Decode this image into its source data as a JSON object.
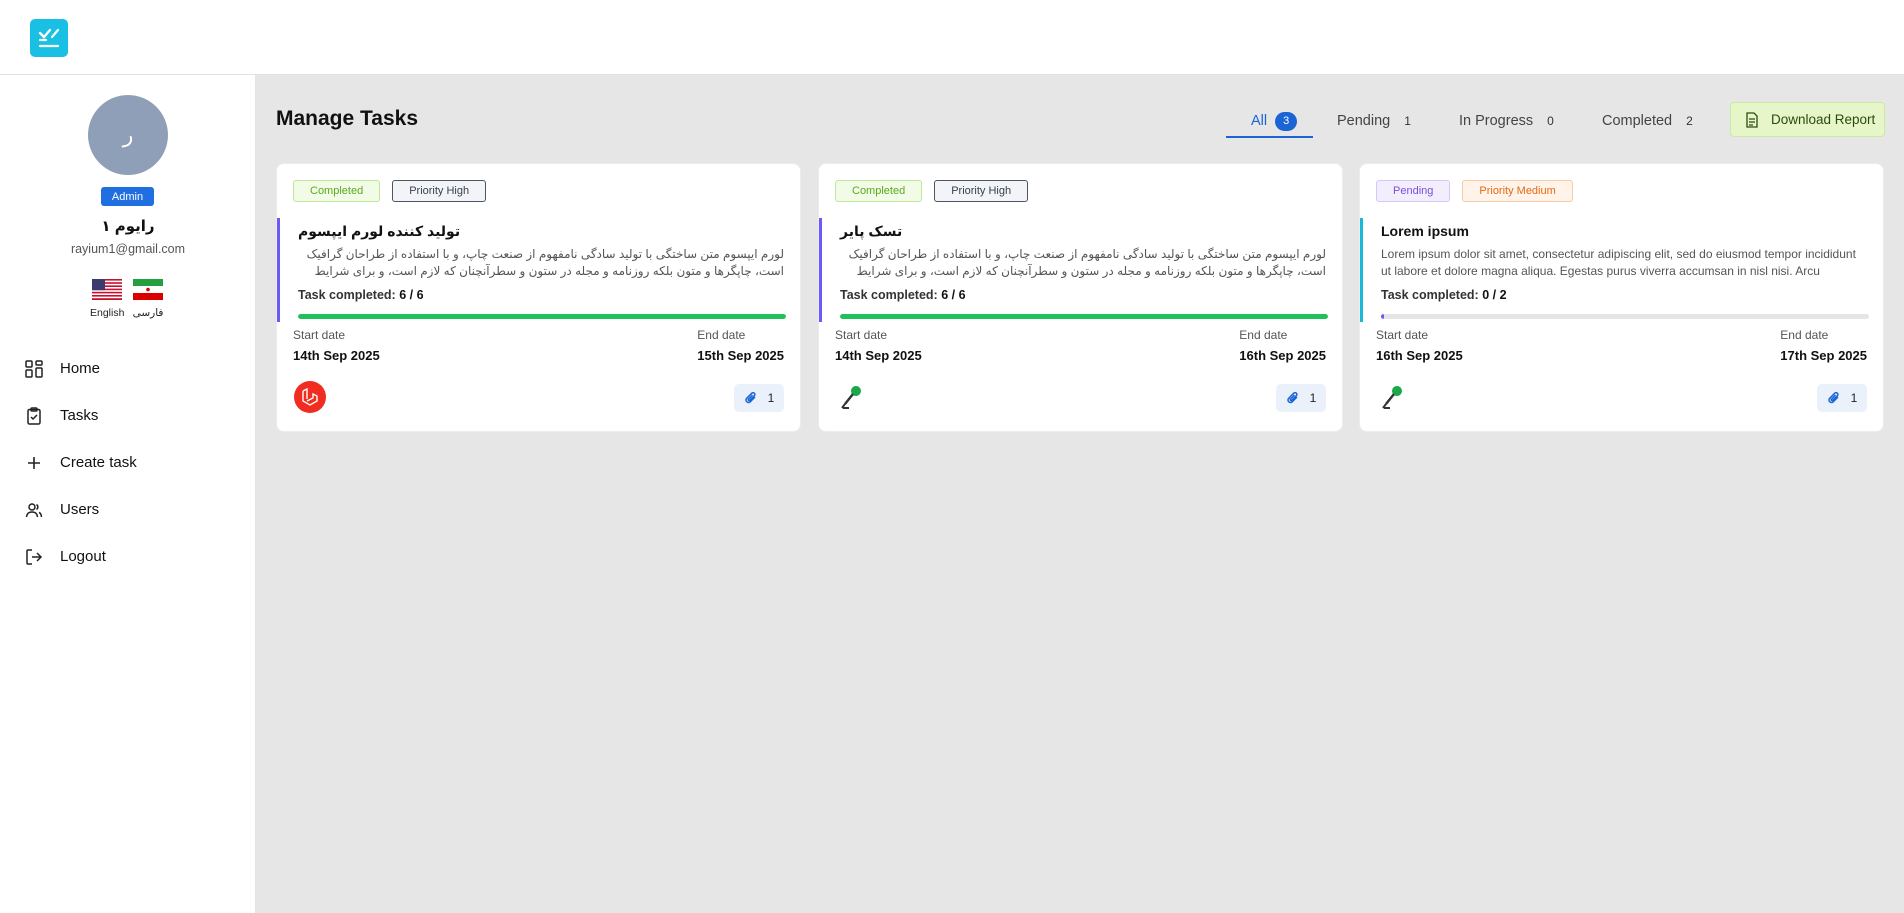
{
  "app": {
    "logo_icon": "checklist-icon"
  },
  "user": {
    "avatar_initial": "ر",
    "role": "Admin",
    "name": "رایوم ۱",
    "email": "rayium1@gmail.com",
    "languages": [
      {
        "label": "English",
        "flag": "us-flag-icon"
      },
      {
        "label": "فارسی",
        "flag": "iran-flag-icon"
      }
    ]
  },
  "nav": {
    "items": [
      {
        "label": "Home",
        "icon": "dashboard-icon"
      },
      {
        "label": "Tasks",
        "icon": "clipboard-icon"
      },
      {
        "label": "Create task",
        "icon": "plus-icon"
      },
      {
        "label": "Users",
        "icon": "users-icon"
      },
      {
        "label": "Logout",
        "icon": "logout-icon"
      }
    ]
  },
  "main": {
    "title": "Manage Tasks",
    "tabs": [
      {
        "label": "All",
        "count": "3",
        "active": true
      },
      {
        "label": "Pending",
        "count": "1"
      },
      {
        "label": "In Progress",
        "count": "0"
      },
      {
        "label": "Completed",
        "count": "2"
      }
    ],
    "download_label": "Download Report",
    "colors": {
      "accent": "#1a64d6",
      "completed": "#5aa920",
      "pending": "#7c4ddb",
      "progress_done": "#20c15a",
      "download_bg": "#e6f6c8"
    }
  },
  "cards": [
    {
      "status": "Completed",
      "priority": "Priority High",
      "title": "تولید کننده لورم ایپسوم",
      "description": "لورم ایپسوم متن ساختگی با تولید سادگی نامفهوم از صنعت چاپ، و با استفاده از طراحان گرافیک است، چاپگرها و متون بلکه روزنامه و مجله در ستون و سطرآنچنان که لازم است، و برای شرایط فعلی تکنولوژی...",
      "progress_label": "Task completed:",
      "progress_value": "6 / 6",
      "progress_fraction": 1.0,
      "start_label": "Start date",
      "start_date": "14th Sep 2025",
      "end_label": "End date",
      "end_date": "15th Sep 2025",
      "attachments": "1",
      "owner_icon": "laravel-logo-icon"
    },
    {
      "status": "Completed",
      "priority": "Priority High",
      "title": "تسک پایر",
      "description": "لورم ایپسوم متن ساختگی با تولید سادگی نامفهوم از صنعت چاپ، و با استفاده از طراحان گرافیک است، چاپگرها و متون بلکه روزنامه و مجله در ستون و سطرآنچنان که لازم است، و برای شرایط فعلی تکنولوژی...",
      "progress_label": "Task completed:",
      "progress_value": "6 / 6",
      "progress_fraction": 1.0,
      "start_label": "Start date",
      "start_date": "14th Sep 2025",
      "end_label": "End date",
      "end_date": "16th Sep 2025",
      "attachments": "1",
      "owner_icon": "microphone-avatar-icon"
    },
    {
      "status": "Pending",
      "priority": "Priority Medium",
      "title": "Lorem ipsum",
      "description": "Lorem ipsum dolor sit amet, consectetur adipiscing elit, sed do eiusmod tempor incididunt ut labore et dolore magna aliqua. Egestas purus viverra accumsan in nisl nisi. Arcu cursus...",
      "progress_label": "Task completed:",
      "progress_value": "0 / 2",
      "progress_fraction": 0.0,
      "start_label": "Start date",
      "start_date": "16th Sep 2025",
      "end_label": "End date",
      "end_date": "17th Sep 2025",
      "attachments": "1",
      "owner_icon": "microphone-avatar-icon"
    }
  ]
}
